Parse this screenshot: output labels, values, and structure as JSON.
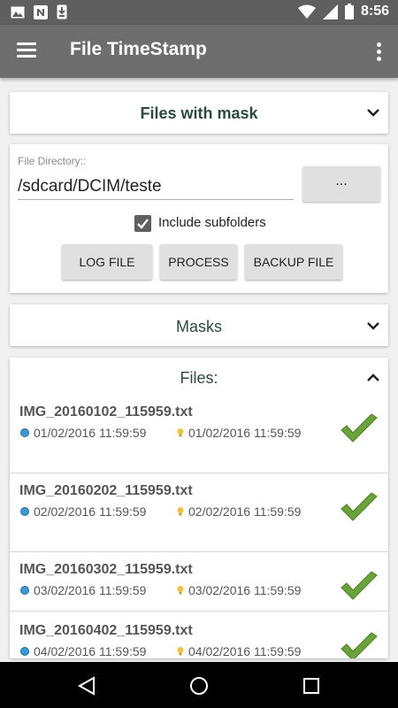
{
  "status_bar": {
    "time": "8:56",
    "icons": [
      "image-icon",
      "n-icon",
      "download-icon",
      "wifi-icon",
      "signal-icon",
      "battery-icon"
    ]
  },
  "app_bar": {
    "title": "File TimeStamp",
    "menu_icon": "hamburger-icon",
    "overflow_icon": "more-vertical-icon"
  },
  "mask_section": {
    "title": "Files with mask"
  },
  "directory": {
    "label": "File Directory::",
    "value": "/sdcard/DCIM/teste",
    "browse_label": "...",
    "include_subfolders_label": "Include subfolders",
    "include_subfolders_checked": true
  },
  "actions": {
    "log_label": "LOG FILE",
    "process_label": "PROCESS",
    "backup_label": "BACKUP FILE"
  },
  "masks_section": {
    "title": "Masks"
  },
  "files_section": {
    "title": "Files:",
    "files": [
      {
        "name": "IMG_20160102_115959.txt",
        "created": "01/02/2016 11:59:59",
        "modified": "01/02/2016 11:59:59",
        "status": "ok"
      },
      {
        "name": "IMG_20160202_115959.txt",
        "created": "02/02/2016 11:59:59",
        "modified": "02/02/2016 11:59:59",
        "status": "ok"
      },
      {
        "name": "IMG_20160302_115959.txt",
        "created": "03/02/2016 11:59:59",
        "modified": "03/02/2016 11:59:59",
        "status": "ok"
      },
      {
        "name": "IMG_20160402_115959.txt",
        "created": "04/02/2016 11:59:59",
        "modified": "04/02/2016 11:59:59",
        "status": "ok"
      }
    ]
  },
  "colors": {
    "app_bar": "#6e6e6e",
    "status_bar": "#5f5f5f",
    "section_title": "#2c4a3e",
    "check_green": "#6aa33a"
  }
}
